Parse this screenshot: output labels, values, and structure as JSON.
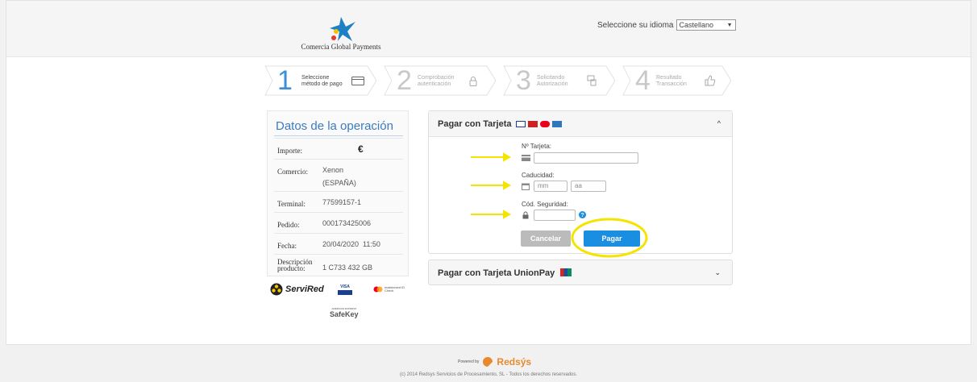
{
  "header": {
    "logo_text": "Comercia Global Payments",
    "language_label": "Seleccione su idioma",
    "language_value": "Castellano"
  },
  "steps": [
    {
      "number": "1",
      "label_line1": "Seleccione",
      "label_line2": "método de pago",
      "icon": "card-icon",
      "active": true
    },
    {
      "number": "2",
      "label_line1": "Comprobación",
      "label_line2": "autenticación",
      "icon": "lock-icon",
      "active": false
    },
    {
      "number": "3",
      "label_line1": "Solicitando",
      "label_line2": "Autorización",
      "icon": "devices-icon",
      "active": false
    },
    {
      "number": "4",
      "label_line1": "Resultado",
      "label_line2": "Transacción",
      "icon": "thumbs-up-icon",
      "active": false
    }
  ],
  "operation": {
    "title": "Datos de la operación",
    "rows": [
      {
        "key": "Importe:",
        "value": "€"
      },
      {
        "key": "Comercio:",
        "value": "Xenon (ESPAÑA)"
      },
      {
        "key": "Terminal:",
        "value": "77599157-1"
      },
      {
        "key": "Pedido:",
        "value": "000173425006"
      },
      {
        "key": "Fecha:",
        "value": "20/04/2020  11:50"
      },
      {
        "key": "Descripción producto:",
        "value": "1 C733 432 GB"
      }
    ],
    "logos": {
      "servired": "ServiRed",
      "visa": "VISA",
      "mastercard": "mastercard ID Check",
      "safekey_small": "AMERICAN EXPRESS",
      "safekey": "SafeKey"
    }
  },
  "card_panel": {
    "title": "Pagar con Tarjeta",
    "card_number_label": "Nº Tarjeta:",
    "card_number_value": "",
    "expiry_label": "Caducidad:",
    "month_placeholder": "mm",
    "year_placeholder": "aa",
    "cvv_label": "Cód. Seguridad:",
    "cvv_value": "",
    "cancel_label": "Cancelar",
    "pay_label": "Pagar"
  },
  "unionpay_panel": {
    "title": "Pagar con Tarjeta UnionPay"
  },
  "footer": {
    "powered_by": "Powered by",
    "brand": "Redsýs",
    "copyright": "(c) 2014 Redsys Servicios de Procesamiento, SL - Todos los derechos reservados."
  },
  "colors": {
    "accent_blue": "#1a8ee0",
    "step_active": "#3b8fdb",
    "annotation_yellow": "#f5e400",
    "title_blue": "#3a7cc0",
    "cancel_gray": "#bbbbbb"
  }
}
